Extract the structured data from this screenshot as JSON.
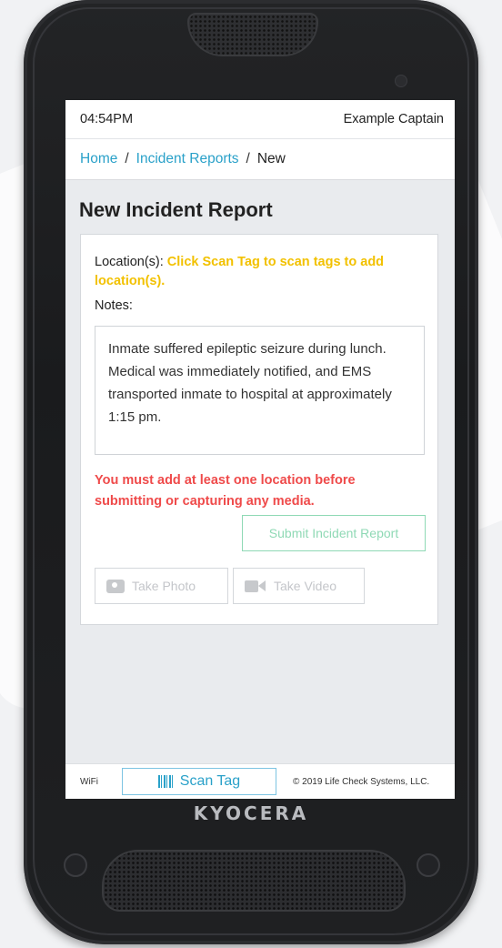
{
  "status_bar": {
    "time": "04:54PM",
    "user": "Example Captain"
  },
  "breadcrumb": {
    "home": "Home",
    "sep1": "/",
    "reports": "Incident Reports",
    "sep2": "/",
    "current": "New"
  },
  "page_title": "New Incident Report",
  "form": {
    "location_label": "Location(s):",
    "location_hint": "Click Scan Tag to scan tags to add location(s).",
    "notes_label": "Notes:",
    "notes_value": "Inmate suffered epileptic seizure during lunch.  Medical was immediately notified, and EMS transported inmate to hospital at approximately 1:15 pm.",
    "error": "You must add at least one location before submitting or capturing any media.",
    "submit_label": "Submit Incident Report",
    "take_photo_label": "Take Photo",
    "take_video_label": "Take Video"
  },
  "footer": {
    "wifi": "WiFi",
    "scan_tag": "Scan Tag",
    "copyright": "© 2019 Life Check Systems, LLC."
  },
  "device": {
    "brand": "KYOCERA"
  },
  "colors": {
    "link": "#2aa1c9",
    "hint": "#f2c100",
    "error": "#ef4a4a",
    "submit": "#8fd9b5"
  },
  "icons": {
    "photo": "camera-icon",
    "video": "video-camera-icon",
    "scan": "barcode-icon"
  }
}
